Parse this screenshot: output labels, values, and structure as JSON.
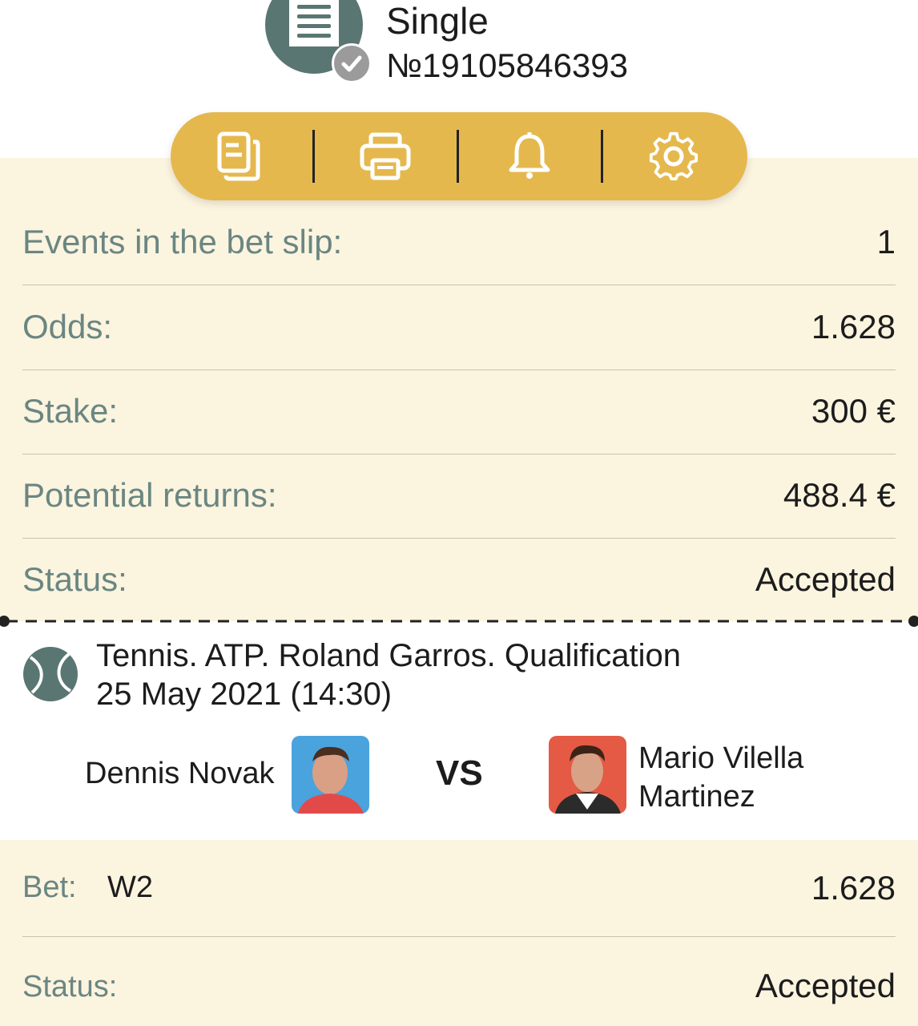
{
  "header": {
    "title": "Single",
    "number": "№19105846393"
  },
  "toolbar": {
    "buttons": [
      "copy-icon",
      "printer-icon",
      "bell-icon",
      "settings-gear-icon"
    ],
    "accent_color": "#e5b84e"
  },
  "summary": {
    "events": {
      "label": "Events in the bet slip:",
      "value": "1"
    },
    "odds": {
      "label": "Odds:",
      "value": "1.628"
    },
    "stake": {
      "label": "Stake:",
      "value": "300 €"
    },
    "returns": {
      "label": "Potential returns:",
      "value": "488.4 €"
    },
    "status": {
      "label": "Status:",
      "value": "Accepted"
    }
  },
  "event": {
    "title": "Tennis. ATP. Roland Garros. Qualification",
    "date": "25 May 2021 (14:30)",
    "player1": "Dennis Novak",
    "vs": "VS",
    "player2_line1": "Mario Vilella",
    "player2_line2": "Martinez"
  },
  "bet": {
    "label": "Bet:",
    "outcome": "W2",
    "odds": "1.628",
    "status_label": "Status:",
    "status_value": "Accepted"
  }
}
